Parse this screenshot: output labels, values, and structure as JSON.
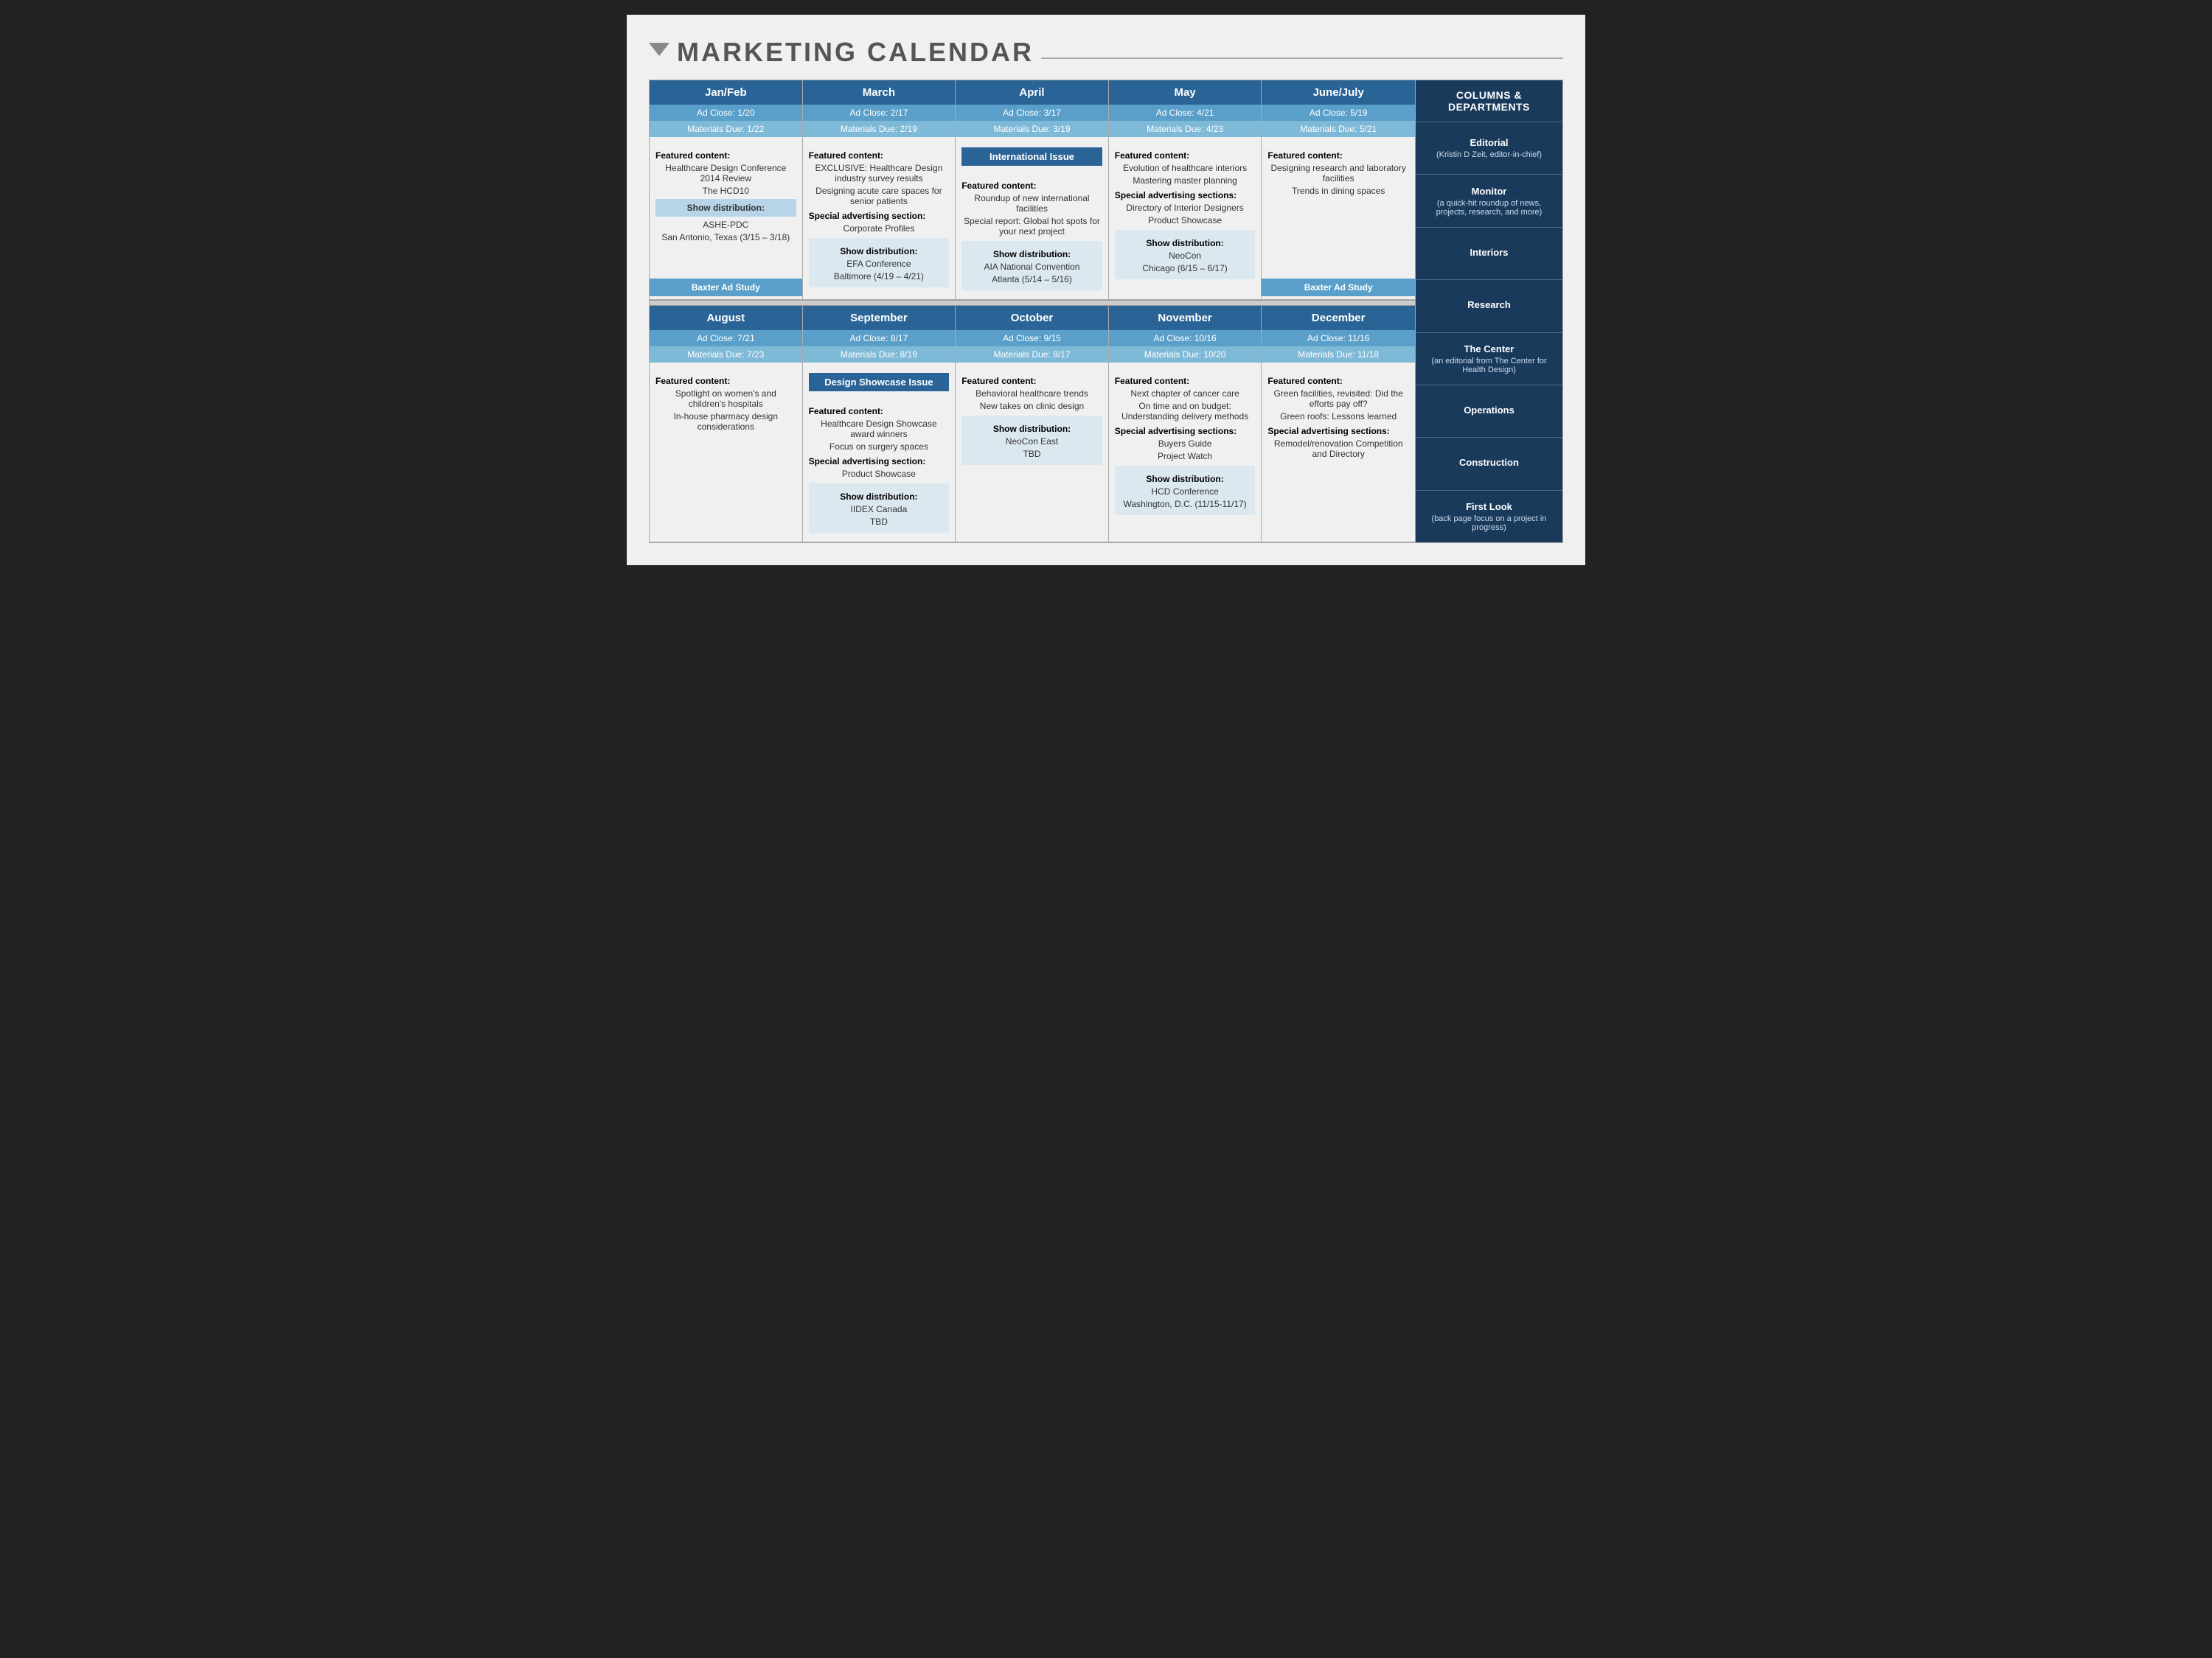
{
  "title": "MARKETING CALENDAR",
  "colors": {
    "dark_blue": "#1a3a5c",
    "medium_blue": "#2a6496",
    "light_blue": "#5a9fc9",
    "pale_blue": "#7fb9d8",
    "highlight_blue": "#b8d4e8",
    "bg": "#f0f0f0",
    "divider": "#ccc"
  },
  "top_row": [
    {
      "month": "Jan/Feb",
      "ad_close": "Ad Close: 1/20",
      "materials_due": "Materials Due: 1/22",
      "featured_label": "Featured content:",
      "featured_items": [
        "Healthcare Design Conference 2014 Review",
        "The HCD10"
      ],
      "special_label": "Show distribution:",
      "special_items": [
        "ASHE-PDC",
        "San Antonio, Texas (3/15 – 3/18)"
      ],
      "baxter": "Baxter Ad Study",
      "show_dist": null
    },
    {
      "month": "March",
      "ad_close": "Ad Close: 2/17",
      "materials_due": "Materials Due: 2/19",
      "featured_label": "Featured content:",
      "featured_items": [
        "EXCLUSIVE: Healthcare Design industry survey results",
        "Designing acute care spaces for senior patients"
      ],
      "special_label": "Special advertising section:",
      "special_items": [
        "Corporate Profiles"
      ],
      "show_dist_label": "Show distribution:",
      "show_dist_items": [
        "EFA Conference",
        "Baltimore (4/19 – 4/21)"
      ]
    },
    {
      "month": "April",
      "ad_close": "Ad Close: 3/17",
      "materials_due": "Materials Due: 3/19",
      "international": "International Issue",
      "featured_label": "Featured content:",
      "featured_items": [
        "Roundup of new international facilities",
        "Special report: Global hot spots for your next project"
      ],
      "show_dist_label": "Show distribution:",
      "show_dist_items": [
        "AIA National Convention",
        "Atlanta (5/14 – 5/16)"
      ]
    },
    {
      "month": "May",
      "ad_close": "Ad Close: 4/21",
      "materials_due": "Materials Due: 4/23",
      "featured_label": "Featured content:",
      "featured_items": [
        "Evolution of healthcare interiors",
        "Mastering master planning"
      ],
      "special_label": "Special advertising sections:",
      "special_items": [
        "Directory of Interior Designers",
        "Product Showcase"
      ],
      "show_dist_label": "Show distribution:",
      "show_dist_items": [
        "NeoCon",
        "Chicago (6/15 – 6/17)"
      ]
    },
    {
      "month": "June/July",
      "ad_close": "Ad Close: 5/19",
      "materials_due": "Materials Due: 5/21",
      "featured_label": "Featured content:",
      "featured_items": [
        "Designing research and laboratory facilities",
        "Trends in dining spaces"
      ],
      "baxter": "Baxter Ad Study",
      "show_dist": null
    }
  ],
  "bottom_row": [
    {
      "month": "August",
      "ad_close": "Ad Close: 7/21",
      "materials_due": "Materials Due: 7/23",
      "featured_label": "Featured content:",
      "featured_items": [
        "Spotlight on women's and children's hospitals",
        "In-house pharmacy design considerations"
      ]
    },
    {
      "month": "September",
      "ad_close": "Ad Close: 8/17",
      "materials_due": "Materials Due: 8/19",
      "design_showcase": "Design Showcase Issue",
      "featured_label": "Featured content:",
      "featured_items": [
        "Healthcare Design Showcase award winners",
        "Focus on surgery spaces"
      ],
      "special_label": "Special advertising section:",
      "special_items": [
        "Product Showcase"
      ],
      "show_dist_label": "Show distribution:",
      "show_dist_items": [
        "IIDEX Canada",
        "TBD"
      ]
    },
    {
      "month": "October",
      "ad_close": "Ad Close: 9/15",
      "materials_due": "Materials Due: 9/17",
      "featured_label": "Featured content:",
      "featured_items": [
        "Behavioral healthcare trends",
        "New takes on clinic design"
      ],
      "show_dist_label": "Show distribution:",
      "show_dist_items": [
        "NeoCon East",
        "TBD"
      ]
    },
    {
      "month": "November",
      "ad_close": "Ad Close: 10/16",
      "materials_due": "Materials Due: 10/20",
      "featured_label": "Featured content:",
      "featured_items": [
        "Next chapter of cancer care",
        "On time and on budget: Understanding delivery methods"
      ],
      "special_label": "Special advertising sections:",
      "special_items": [
        "Buyers Guide",
        "Project Watch"
      ],
      "show_dist_label": "Show distribution:",
      "show_dist_items": [
        "HCD Conference",
        "Washington, D.C. (11/15-11/17)"
      ]
    },
    {
      "month": "December",
      "ad_close": "Ad Close: 11/16",
      "materials_due": "Materials Due: 11/18",
      "featured_label": "Featured content:",
      "featured_items": [
        "Green facilities, revisited: Did the efforts pay off?",
        "Green roofs: Lessons learned"
      ],
      "special_label": "Special advertising sections:",
      "special_items": [
        "Remodel/renovation Competition and Directory"
      ]
    }
  ],
  "departments": {
    "header": "COLUMNS &\nDEPARTMENTS",
    "items": [
      {
        "title": "Editorial",
        "sub": "(Kristin D Zeit, editor-in-chief)"
      },
      {
        "title": "Monitor",
        "sub": "(a quick-hit roundup of news, projects, research, and more)"
      },
      {
        "title": "Interiors",
        "sub": ""
      },
      {
        "title": "Research",
        "sub": ""
      },
      {
        "title": "The Center",
        "sub": "(an editorial from The Center for Health Design)"
      },
      {
        "title": "Operations",
        "sub": ""
      },
      {
        "title": "Construction",
        "sub": ""
      },
      {
        "title": "First Look",
        "sub": "(back page focus on a project in progress)"
      }
    ]
  }
}
